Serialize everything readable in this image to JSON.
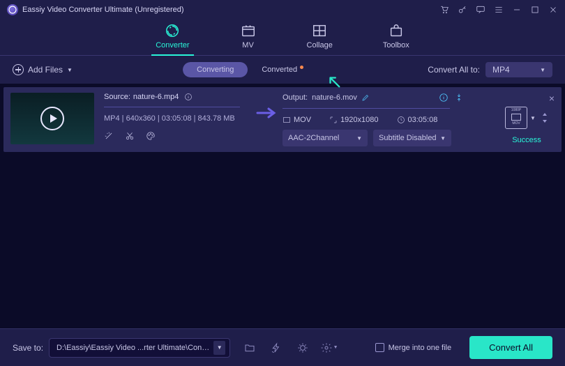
{
  "app_title": "Eassiy Video Converter Ultimate (Unregistered)",
  "nav": {
    "converter": "Converter",
    "mv": "MV",
    "collage": "Collage",
    "toolbox": "Toolbox"
  },
  "subbar": {
    "add_files": "Add Files",
    "tab_converting": "Converting",
    "tab_converted": "Converted",
    "convert_all_to": "Convert All to:",
    "format": "MP4"
  },
  "item": {
    "source_label": "Source:",
    "source_name": "nature-6.mp4",
    "source_meta": "MP4 | 640x360 | 03:05:08 | 843.78 MB",
    "output_label": "Output:",
    "output_name": "nature-6.mov",
    "out_format": "MOV",
    "out_res": "1920x1080",
    "out_dur": "03:05:08",
    "audio_dd": "AAC-2Channel",
    "subtitle_dd": "Subtitle Disabled",
    "profile_top": "1080P",
    "success": "Success"
  },
  "footer": {
    "save_to": "Save to:",
    "path": "D:\\Eassiy\\Eassiy Video ...rter Ultimate\\Converted",
    "merge": "Merge into one file",
    "convert_all": "Convert All"
  }
}
